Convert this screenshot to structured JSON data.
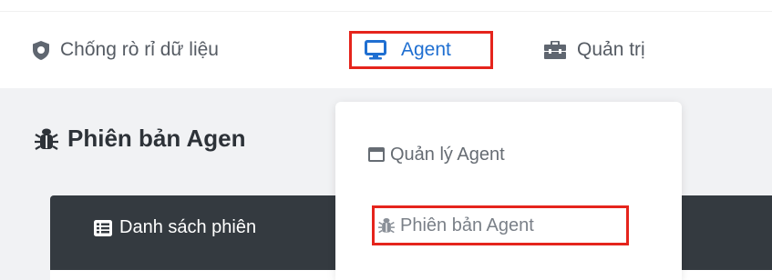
{
  "nav": {
    "items": [
      {
        "label": "Chống rò rỉ dữ liệu",
        "icon": "shield-icon"
      },
      {
        "label": "Agent",
        "icon": "desktop-icon",
        "active": true
      },
      {
        "label": "Quản trị",
        "icon": "toolbox-icon"
      }
    ]
  },
  "page": {
    "title": "Phiên bản Agen",
    "title_icon": "bug-icon"
  },
  "card": {
    "title": "Danh sách phiên",
    "title_icon": "list-alt-icon"
  },
  "dropdown": {
    "items": [
      {
        "label": "Quản lý Agent",
        "icon": "window-icon"
      },
      {
        "label": "Phiên bản Agent",
        "icon": "bug-icon",
        "highlighted": true
      }
    ]
  },
  "colors": {
    "accent": "#1f6fd1",
    "highlight_border": "#e5241c",
    "card_header_bg": "#343a40",
    "content_bg": "#f1f2f4"
  }
}
